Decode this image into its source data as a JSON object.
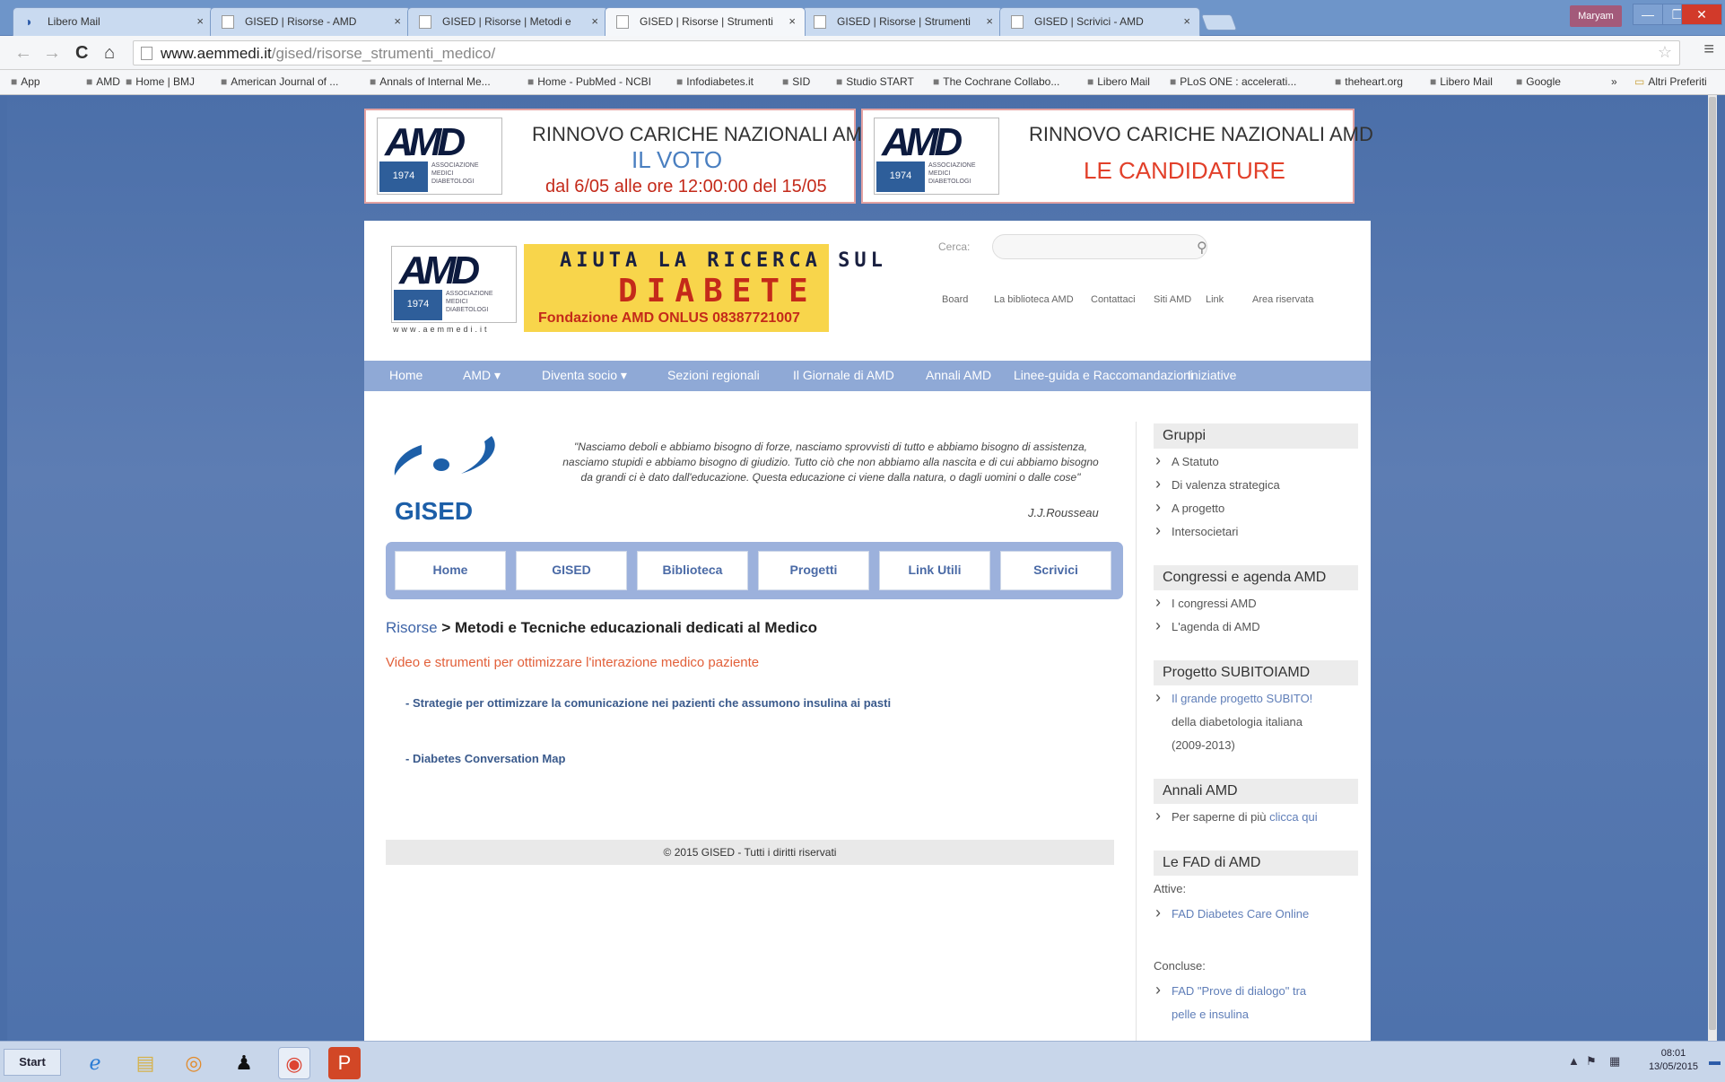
{
  "browser": {
    "tabs": [
      {
        "title": "Libero Mail",
        "icon": "libero-icon"
      },
      {
        "title": "GISED | Risorse - AMD",
        "icon": "page-icon"
      },
      {
        "title": "GISED | Risorse | Metodi e",
        "icon": "page-icon"
      },
      {
        "title": "GISED | Risorse | Strumenti",
        "icon": "page-icon",
        "active": true
      },
      {
        "title": "GISED | Risorse | Strumenti",
        "icon": "page-icon"
      },
      {
        "title": "GISED | Scrivici - AMD",
        "icon": "page-icon"
      }
    ],
    "close_glyph": "×",
    "user": "Maryam",
    "window_buttons": {
      "minimize": "—",
      "maximize": "❐",
      "close": "✕"
    },
    "url_host": "www.aemmedi.it",
    "url_path": "/gised/risorse_strumenti_medico/",
    "nav_glyphs": {
      "back": "←",
      "forward": "→",
      "reload": "C",
      "home": "⌂",
      "star": "☆",
      "menu": "≡"
    },
    "bookmarks": [
      {
        "label": "App",
        "icon": "apps-icon"
      },
      {
        "label": "AMD",
        "icon": "page-icon"
      },
      {
        "label": "Home | BMJ",
        "icon": "bmj-icon"
      },
      {
        "label": "American Journal of ...",
        "icon": "page-icon"
      },
      {
        "label": "Annals of Internal Me...",
        "icon": "annals-icon"
      },
      {
        "label": "Home - PubMed - NCBI",
        "icon": "pubmed-icon"
      },
      {
        "label": "Infodiabetes.it",
        "icon": "page-icon"
      },
      {
        "label": "SID",
        "icon": "sid-icon"
      },
      {
        "label": "Studio START",
        "icon": "page-icon"
      },
      {
        "label": "The Cochrane Collabo...",
        "icon": "cochrane-icon"
      },
      {
        "label": "Libero Mail",
        "icon": "libero-icon"
      },
      {
        "label": "PLoS ONE : accelerati...",
        "icon": "plos-icon"
      },
      {
        "label": "theheart.org",
        "icon": "heart-icon"
      },
      {
        "label": "Libero Mail",
        "icon": "libero-icon"
      },
      {
        "label": "Google",
        "icon": "google-icon"
      }
    ],
    "bookmarks_more": "»",
    "other_bookmarks": "Altri Preferiti"
  },
  "banners": [
    {
      "logo": "AMD",
      "year": "1974",
      "logo_sub": "Associazione Medici Diabetologi",
      "title": "RINNOVO CARICHE NAZIONALI AMD",
      "subtitle": "IL VOTO",
      "detail": "dal 6/05  alle ore 12:00:00 del 15/05",
      "subtitle_color": "#4a7fc0"
    },
    {
      "logo": "AMD",
      "year": "1974",
      "logo_sub": "Associazione Medici Diabetologi",
      "title": "RINNOVO CARICHE NAZIONALI AMD",
      "subtitle": "LE CANDIDATURE",
      "detail": "",
      "subtitle_color": "#e2402a"
    }
  ],
  "header": {
    "logo": "AMD",
    "year": "1974",
    "logo_sub": "Associazione Medici Diabetologi",
    "www": "www.aemmedi.it",
    "donate": {
      "line1": "AIUTA LA RICERCA SUL",
      "line2": "DIABETE",
      "line3": "Fondazione AMD ONLUS 08387721007"
    },
    "search_label": "Cerca:",
    "search_value": "",
    "top_links": [
      "Board",
      "La biblioteca AMD",
      "Contattaci",
      "Siti AMD",
      "Link",
      "Area riservata"
    ]
  },
  "nav": [
    "Home",
    "AMD ▾",
    "Diventa socio ▾",
    "Sezioni regionali",
    "Il Giornale di AMD",
    "Annali AMD",
    "Linee-guida e Raccomandazioni",
    "Iniziative"
  ],
  "gised": {
    "name": "GISED",
    "quote": "\"Nasciamo deboli e abbiamo bisogno di forze, nasciamo sprovvisti di tutto e abbiamo bisogno di assistenza, nasciamo stupidi e abbiamo bisogno di giudizio. Tutto ciò che non abbiamo alla nascita e di cui abbiamo bisogno da grandi ci è dato dall'educazione. Questa educazione ci viene dalla natura, o dagli uomini o dalle cose\"",
    "author": "J.J.Rousseau"
  },
  "subnav": [
    "Home",
    "GISED",
    "Biblioteca",
    "Progetti",
    "Link Utili",
    "Scrivici"
  ],
  "content": {
    "crumb_link": "Risorse",
    "crumb_sep": " > ",
    "crumb_current": "Metodi e Tecniche educazionali dedicati al Medico",
    "intro": "Video e strumenti per ottimizzare l'interazione medico paziente",
    "links": [
      "- Strategie per ottimizzare la comunicazione nei pazienti che assumono insulina ai pasti",
      "- Diabetes Conversation Map"
    ],
    "footer": "© 2015 GISED - Tutti i diritti riservati"
  },
  "sidebar": {
    "groups_title": "Gruppi",
    "groups": [
      "A Statuto",
      "Di valenza strategica",
      "A progetto",
      "Intersocietari"
    ],
    "congressi_title": "Congressi e agenda AMD",
    "congressi": [
      "I congressi AMD",
      "L'agenda di AMD"
    ],
    "subito_title": "Progetto SUBITOIAMD",
    "subito_link": "Il grande progetto SUBITO!",
    "subito_rest1": "della diabetologia italiana",
    "subito_rest2": "(2009-2013)",
    "annali_title": "Annali AMD",
    "annali_text": "Per saperne di più ",
    "annali_link": "clicca qui",
    "fad_title": "Le FAD di AMD",
    "fad_active_label": "Attive:",
    "fad_active": "FAD Diabetes Care Online",
    "fad_closed_label": "Concluse:",
    "fad_closed_1": "FAD \"Prove di dialogo\" tra",
    "fad_closed_2": "pelle e insulina"
  },
  "taskbar": {
    "start": "Start",
    "icons": [
      "ie-icon",
      "explorer-icon",
      "outlook-icon",
      "user-icon",
      "chrome-icon",
      "powerpoint-icon"
    ],
    "time": "08:01",
    "date": "13/05/2015"
  }
}
